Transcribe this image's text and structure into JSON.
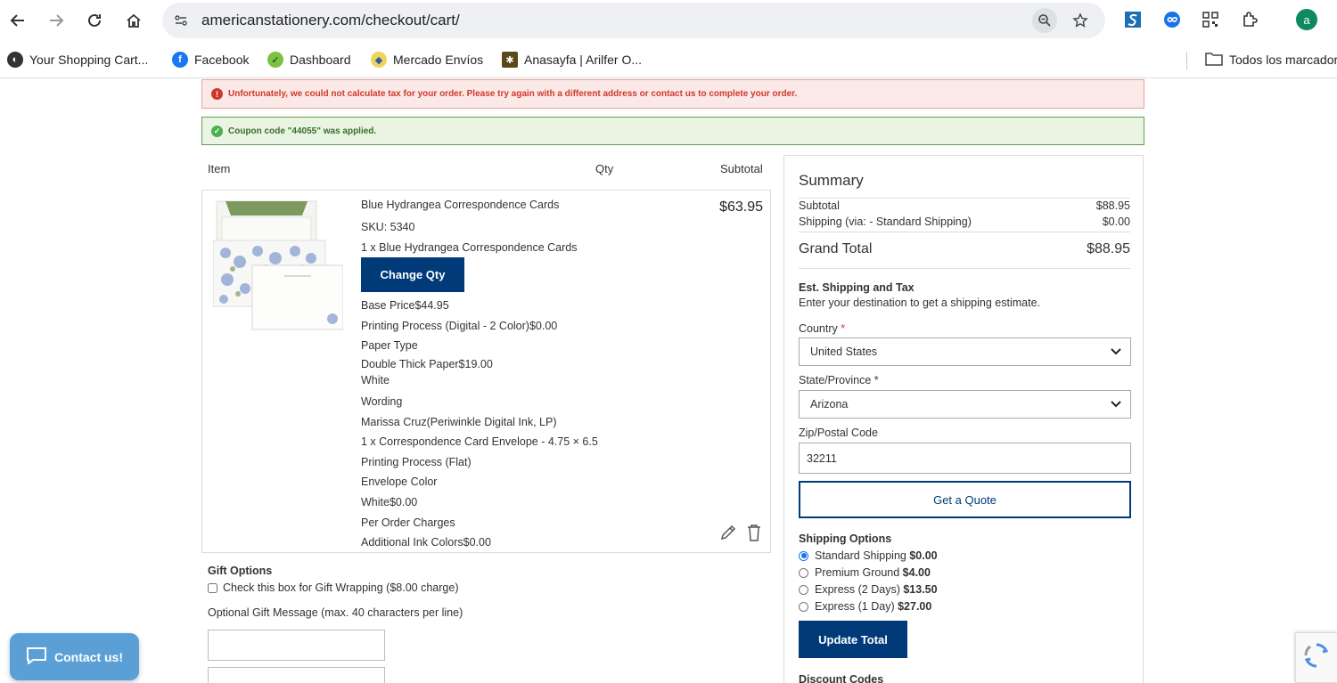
{
  "browser": {
    "url": "americanstationery.com/checkout/cart/",
    "bookmarks": [
      {
        "label": "Your Shopping Cart...",
        "icon": "globe-icon"
      },
      {
        "label": "Facebook",
        "icon": "facebook-icon"
      },
      {
        "label": "Dashboard",
        "icon": "dashboard-icon"
      },
      {
        "label": "Mercado Envíos",
        "icon": "mercado-icon"
      },
      {
        "label": "Anasayfa | Arilfer O...",
        "icon": "arilfer-icon"
      }
    ],
    "all_bookmarks": "Todos los marcadores",
    "profile_initial": "a"
  },
  "messages": {
    "error": "Unfortunately, we could not calculate tax for your order. Please try again with a different address or contact us to complete your order.",
    "success": "Coupon code \"44055\" was applied."
  },
  "cart": {
    "headers": {
      "item": "Item",
      "qty": "Qty",
      "subtotal": "Subtotal"
    },
    "item": {
      "name": "Blue Hydrangea Correspondence Cards",
      "sku": "SKU: 5340",
      "quantity_line": "1 x Blue Hydrangea Correspondence Cards",
      "change_qty": "Change Qty",
      "price": "$63.95",
      "options": [
        "Base Price$44.95",
        "Printing Process (Digital - 2 Color)$0.00",
        "Paper Type",
        "Double Thick Paper$19.00",
        "White",
        "Wording",
        "Marissa Cruz(Periwinkle Digital Ink, LP)",
        "1 x Correspondence Card Envelope - 4.75 × 6.5",
        "Printing Process (Flat)",
        "Envelope Color",
        "White$0.00",
        "Per Order Charges",
        "Additional Ink Colors$0.00"
      ]
    },
    "gift": {
      "title": "Gift Options",
      "wrap_label": "Check this box for Gift Wrapping ($8.00 charge)",
      "message_label": "Optional Gift Message (max. 40 characters per line)"
    }
  },
  "summary": {
    "title": "Summary",
    "subtotal_label": "Subtotal",
    "subtotal_value": "$88.95",
    "shipping_label": "Shipping (via: - Standard Shipping)",
    "shipping_value": "$0.00",
    "grand_label": "Grand Total",
    "grand_value": "$88.95",
    "est_title": "Est. Shipping and Tax",
    "est_sub": "Enter your destination to get a shipping estimate.",
    "country_label": "Country",
    "country_value": "United States",
    "state_label": "State/Province",
    "state_value": "Arizona",
    "zip_label": "Zip/Postal Code",
    "zip_value": "32211",
    "quote_button": "Get a Quote",
    "shipping_options_title": "Shipping Options",
    "shipping_options": [
      {
        "label": "Standard Shipping",
        "price": "$0.00",
        "selected": true
      },
      {
        "label": "Premium Ground",
        "price": "$4.00",
        "selected": false
      },
      {
        "label": "Express (2 Days)",
        "price": "$13.50",
        "selected": false
      },
      {
        "label": "Express (1 Day)",
        "price": "$27.00",
        "selected": false
      }
    ],
    "update_button": "Update Total",
    "discount_title": "Discount Codes"
  },
  "contact_button": "Contact us!",
  "colors": {
    "brand": "#003a79",
    "error": "#d0382b",
    "success": "#3a6e2a",
    "contact": "#5aa0d6"
  }
}
